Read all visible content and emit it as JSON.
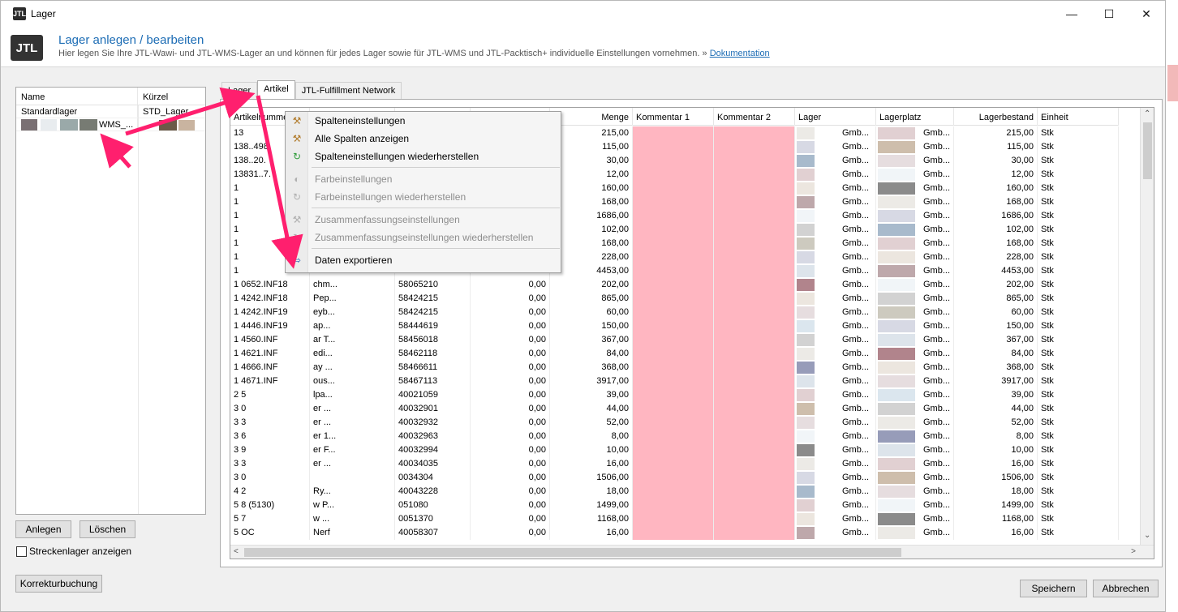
{
  "window": {
    "title": "Lager",
    "app_icon": "JTL",
    "buttons": [
      "minimize-icon",
      "maximize-icon",
      "close-icon"
    ]
  },
  "header": {
    "logo": "JTL",
    "title": "Lager anlegen / bearbeiten",
    "subtitle": "Hier legen Sie Ihre JTL-Wawi- und JTL-WMS-Lager an und können für jedes Lager sowie für JTL-WMS und JTL-Packtisch+ individuelle Einstellungen vornehmen.",
    "link_prefix": "»",
    "link": "Dokumentation"
  },
  "lager_list": {
    "headers": [
      "Name",
      "Kürzel"
    ],
    "rows": [
      {
        "name": "Standardlager",
        "kurz": "STD_Lager"
      },
      {
        "name": "WMS_...",
        "kurz": ""
      }
    ]
  },
  "left_buttons": {
    "anlegen": "Anlegen",
    "loeschen": "Löschen"
  },
  "strecken": {
    "label": "Streckenlager anzeigen",
    "checked": false
  },
  "tabs": [
    {
      "label": "Lager",
      "active": false
    },
    {
      "label": "Artikel",
      "active": true
    },
    {
      "label": "JTL-Fulfillment Network",
      "active": false
    }
  ],
  "grid": {
    "headers": [
      "Artikelnummer",
      "",
      "",
      "",
      "Menge",
      "Kommentar 1",
      "Kommentar 2",
      "Lager",
      "Lagerplatz",
      "Lagerbestand",
      "Einheit"
    ],
    "rows": [
      {
        "art": "13",
        "c2": "",
        "c3": "",
        "c4": "",
        "menge": "215,00",
        "lager": "Gmb...",
        "platz": "Gmb...",
        "bestand": "215,00",
        "einheit": "Stk"
      },
      {
        "art": "138..498.",
        "c2": "",
        "c3": "",
        "c4": "",
        "menge": "115,00",
        "lager": "Gmb...",
        "platz": "Gmb...",
        "bestand": "115,00",
        "einheit": "Stk"
      },
      {
        "art": "138..20.",
        "c2": "",
        "c3": "",
        "c4": "",
        "menge": "30,00",
        "lager": "Gmb...",
        "platz": "Gmb...",
        "bestand": "30,00",
        "einheit": "Stk"
      },
      {
        "art": "13831..7.",
        "c2": "",
        "c3": "",
        "c4": "",
        "menge": "12,00",
        "lager": "Gmb...",
        "platz": "Gmb...",
        "bestand": "12,00",
        "einheit": "Stk"
      },
      {
        "art": "1",
        "c2": "",
        "c3": "",
        "c4": "",
        "menge": "160,00",
        "lager": "Gmb...",
        "platz": "Gmb...",
        "bestand": "160,00",
        "einheit": "Stk"
      },
      {
        "art": "1",
        "c2": "",
        "c3": "",
        "c4": "",
        "menge": "168,00",
        "lager": "Gmb...",
        "platz": "Gmb...",
        "bestand": "168,00",
        "einheit": "Stk"
      },
      {
        "art": "1",
        "c2": "",
        "c3": "",
        "c4": "",
        "menge": "1686,00",
        "lager": "Gmb...",
        "platz": "Gmb...",
        "bestand": "1686,00",
        "einheit": "Stk"
      },
      {
        "art": "1",
        "c2": "",
        "c3": "",
        "c4": "",
        "menge": "102,00",
        "lager": "Gmb...",
        "platz": "Gmb...",
        "bestand": "102,00",
        "einheit": "Stk"
      },
      {
        "art": "1",
        "c2": "",
        "c3": "",
        "c4": "",
        "menge": "168,00",
        "lager": "Gmb...",
        "platz": "Gmb...",
        "bestand": "168,00",
        "einheit": "Stk"
      },
      {
        "art": "1",
        "c2": "",
        "c3": "",
        "c4": "",
        "menge": "228,00",
        "lager": "Gmb...",
        "platz": "Gmb...",
        "bestand": "228,00",
        "einheit": "Stk"
      },
      {
        "art": "1",
        "c2": "",
        "c3": "",
        "c4": "",
        "menge": "4453,00",
        "lager": "Gmb...",
        "platz": "Gmb...",
        "bestand": "4453,00",
        "einheit": "Stk"
      },
      {
        "art": "1 0652.INF18",
        "c2": "chm...",
        "c3": "58065210",
        "c4": "0,00",
        "menge": "202,00",
        "lager": "Gmb...",
        "platz": "Gmb...",
        "bestand": "202,00",
        "einheit": "Stk"
      },
      {
        "art": "1 4242.INF18",
        "c2": "Pep...",
        "c3": "58424215",
        "c4": "0,00",
        "menge": "865,00",
        "lager": "Gmb...",
        "platz": "Gmb...",
        "bestand": "865,00",
        "einheit": "Stk"
      },
      {
        "art": "1 4242.INF19",
        "c2": "eyb...",
        "c3": "58424215",
        "c4": "0,00",
        "menge": "60,00",
        "lager": "Gmb...",
        "platz": "Gmb...",
        "bestand": "60,00",
        "einheit": "Stk"
      },
      {
        "art": "1 4446.INF19",
        "c2": "ap...",
        "c3": "58444619",
        "c4": "0,00",
        "menge": "150,00",
        "lager": "Gmb...",
        "platz": "Gmb...",
        "bestand": "150,00",
        "einheit": "Stk"
      },
      {
        "art": "1 4560.INF",
        "c2": "ar T...",
        "c3": "58456018",
        "c4": "0,00",
        "menge": "367,00",
        "lager": "Gmb...",
        "platz": "Gmb...",
        "bestand": "367,00",
        "einheit": "Stk"
      },
      {
        "art": "1 4621.INF",
        "c2": "edi...",
        "c3": "58462118",
        "c4": "0,00",
        "menge": "84,00",
        "lager": "Gmb...",
        "platz": "Gmb...",
        "bestand": "84,00",
        "einheit": "Stk"
      },
      {
        "art": "1 4666.INF",
        "c2": "ay ...",
        "c3": "58466611",
        "c4": "0,00",
        "menge": "368,00",
        "lager": "Gmb...",
        "platz": "Gmb...",
        "bestand": "368,00",
        "einheit": "Stk"
      },
      {
        "art": "1 4671.INF",
        "c2": "ous...",
        "c3": "58467113",
        "c4": "0,00",
        "menge": "3917,00",
        "lager": "Gmb...",
        "platz": "Gmb...",
        "bestand": "3917,00",
        "einheit": "Stk"
      },
      {
        "art": "2 5",
        "c2": "lpa...",
        "c3": "40021059",
        "c4": "0,00",
        "menge": "39,00",
        "lager": "Gmb...",
        "platz": "Gmb...",
        "bestand": "39,00",
        "einheit": "Stk"
      },
      {
        "art": "3 0",
        "c2": "er ...",
        "c3": "40032901",
        "c4": "0,00",
        "menge": "44,00",
        "lager": "Gmb...",
        "platz": "Gmb...",
        "bestand": "44,00",
        "einheit": "Stk"
      },
      {
        "art": "3 3",
        "c2": "er ...",
        "c3": "40032932",
        "c4": "0,00",
        "menge": "52,00",
        "lager": "Gmb...",
        "platz": "Gmb...",
        "bestand": "52,00",
        "einheit": "Stk"
      },
      {
        "art": "3 6",
        "c2": "er 1...",
        "c3": "40032963",
        "c4": "0,00",
        "menge": "8,00",
        "lager": "Gmb...",
        "platz": "Gmb...",
        "bestand": "8,00",
        "einheit": "Stk"
      },
      {
        "art": "3 9",
        "c2": "er F...",
        "c3": "40032994",
        "c4": "0,00",
        "menge": "10,00",
        "lager": "Gmb...",
        "platz": "Gmb...",
        "bestand": "10,00",
        "einheit": "Stk"
      },
      {
        "art": "3 3",
        "c2": "er ...",
        "c3": "40034035",
        "c4": "0,00",
        "menge": "16,00",
        "lager": "Gmb...",
        "platz": "Gmb...",
        "bestand": "16,00",
        "einheit": "Stk"
      },
      {
        "art": "3 0",
        "c2": "",
        "c3": "0034304",
        "c4": "0,00",
        "menge": "1506,00",
        "lager": "Gmb...",
        "platz": "Gmb...",
        "bestand": "1506,00",
        "einheit": "Stk"
      },
      {
        "art": "4 2",
        "c2": "Ry...",
        "c3": "40043228",
        "c4": "0,00",
        "menge": "18,00",
        "lager": "Gmb...",
        "platz": "Gmb...",
        "bestand": "18,00",
        "einheit": "Stk"
      },
      {
        "art": "5 8 (5130)",
        "c2": "w P...",
        "c3": "051080",
        "c4": "0,00",
        "menge": "1499,00",
        "lager": "Gmb...",
        "platz": "Gmb...",
        "bestand": "1499,00",
        "einheit": "Stk"
      },
      {
        "art": "5 7",
        "c2": "w ...",
        "c3": "0051370",
        "c4": "0,00",
        "menge": "1168,00",
        "lager": "Gmb...",
        "platz": "Gmb...",
        "bestand": "1168,00",
        "einheit": "Stk"
      },
      {
        "art": "5 OC",
        "c2": "Nerf",
        "c3": "40058307",
        "c4": "0,00",
        "menge": "16,00",
        "lager": "Gmb...",
        "platz": "Gmb...",
        "bestand": "16,00",
        "einheit": "Stk"
      }
    ]
  },
  "context_menu": {
    "items": [
      {
        "label": "Spalteneinstellungen",
        "icon": "tools-icon",
        "disabled": false
      },
      {
        "label": "Alle Spalten anzeigen",
        "icon": "tools-icon",
        "disabled": false
      },
      {
        "label": "Spalteneinstellungen wiederherstellen",
        "icon": "refresh-icon",
        "disabled": false
      },
      {
        "label": "Farbeinstellungen",
        "icon": "palette-icon",
        "disabled": true
      },
      {
        "label": "Farbeinstellungen wiederherstellen",
        "icon": "refresh-icon",
        "disabled": true
      },
      {
        "label": "Zusammenfassungseinstellungen",
        "icon": "tools-icon",
        "disabled": true
      },
      {
        "label": "Zusammenfassungseinstellungen wiederherstellen",
        "icon": "refresh-icon",
        "disabled": true
      },
      {
        "label": "Daten exportieren",
        "icon": "export-icon",
        "disabled": false
      }
    ]
  },
  "bottom": {
    "korrektur": "Korrekturbuchung",
    "speichern": "Speichern",
    "abbrechen": "Abbrechen"
  },
  "colors": {
    "accent": "#1d6db5",
    "comment_bg": "#ffb6c1",
    "arrow": "#ff1f6e"
  }
}
